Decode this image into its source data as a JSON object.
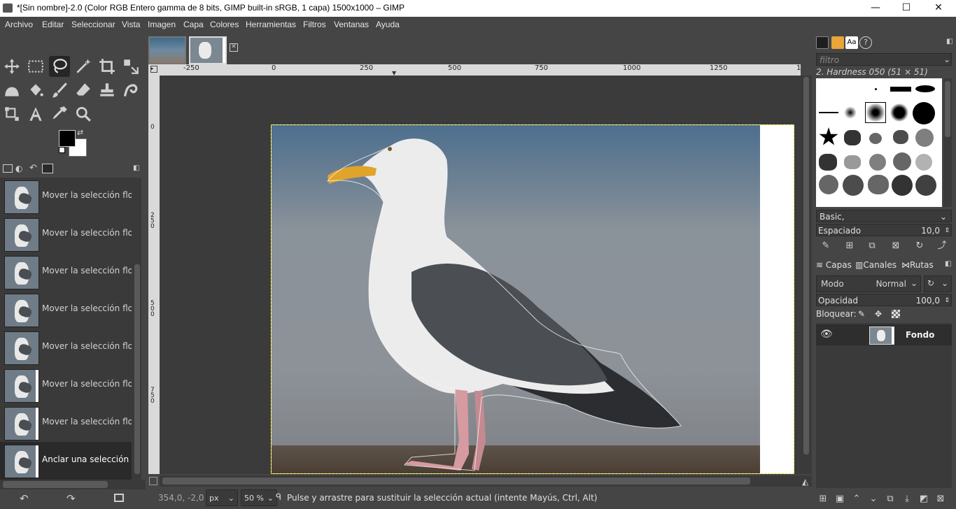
{
  "window": {
    "title": "*[Sin nombre]-2.0 (Color RGB Entero gamma de 8 bits, GIMP built-in sRGB, 1 capa) 1500x1000 – GIMP",
    "minimize": "—",
    "maximize": "☐",
    "close": "✕"
  },
  "menu": [
    "Archivo",
    "Editar",
    "Seleccionar",
    "Vista",
    "Imagen",
    "Capa",
    "Colores",
    "Herramientas",
    "Filtros",
    "Ventanas",
    "Ayuda"
  ],
  "toolbox": {
    "tools": [
      "move-icon",
      "rect-select-icon",
      "free-select-icon",
      "fuzzy-select-icon",
      "crop-icon",
      "transform-icon",
      "warp-icon",
      "bucket-fill-icon",
      "paintbrush-icon",
      "eraser-icon",
      "clone-icon",
      "smudge-icon",
      "paths-icon",
      "text-icon",
      "color-picker-icon",
      "zoom-icon"
    ],
    "active_tool": "free-select-icon",
    "fg_color": "#000000",
    "bg_color": "#ffffff"
  },
  "history": {
    "items": [
      {
        "label": "Mover la selección flotante",
        "edge": false,
        "selected": false
      },
      {
        "label": "Mover la selección flotante",
        "edge": false,
        "selected": false
      },
      {
        "label": "Mover la selección flotante",
        "edge": false,
        "selected": false
      },
      {
        "label": "Mover la selección flotante",
        "edge": false,
        "selected": false
      },
      {
        "label": "Mover la selección flotante",
        "edge": false,
        "selected": false
      },
      {
        "label": "Mover la selección flotante",
        "edge": true,
        "selected": false
      },
      {
        "label": "Mover la selección flotante",
        "edge": true,
        "selected": false
      },
      {
        "label": "Anclar una selección flotante",
        "edge": true,
        "selected": true
      }
    ],
    "undo_icon": "↶",
    "redo_icon": "↷",
    "clear_icon": "🗑"
  },
  "rulers": {
    "h_ticks": [
      "-250",
      "0",
      "250",
      "500",
      "750",
      "1000",
      "1250",
      "1"
    ],
    "v_ticks": [
      "0",
      "250",
      "500",
      "750"
    ]
  },
  "status": {
    "coords": "354,0, -2,0",
    "unit": "px",
    "zoom": "50 %",
    "message": "Pulse y arrastre para sustituir la selección actual (intente Mayús, Ctrl, Alt)"
  },
  "brushes": {
    "filter_placeholder": "filtro",
    "current": "2. Hardness 050 (51 × 51)",
    "set": "Basic,",
    "spacing_label": "Espaciado",
    "spacing_value": "10,0"
  },
  "layers": {
    "tabs": [
      "Capas",
      "Canales",
      "Rutas"
    ],
    "mode_label": "Modo",
    "mode_value": "Normal",
    "opacity_label": "Opacidad",
    "opacity_value": "100,0",
    "lock_label": "Bloquear:",
    "items": [
      {
        "name": "Fondo",
        "visible": true
      }
    ]
  }
}
